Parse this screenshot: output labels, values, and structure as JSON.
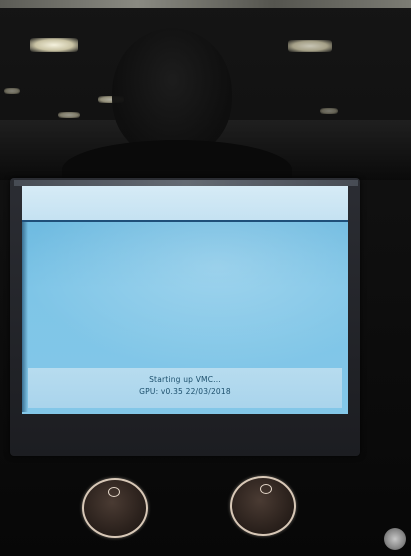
{
  "screen": {
    "status_line_1": "Starting up VMC...",
    "status_line_2": "GPU: v0.35 22/03/2018"
  },
  "icons": {
    "left_button": "circle-button-icon",
    "right_button": "circle-button-icon",
    "corner": "badge-icon"
  },
  "colors": {
    "screen_blue": "#7ec5e7",
    "title_bar": "#d6ebf6",
    "status_text": "#1c4f6c",
    "button_ring": "#d8c8b7"
  }
}
